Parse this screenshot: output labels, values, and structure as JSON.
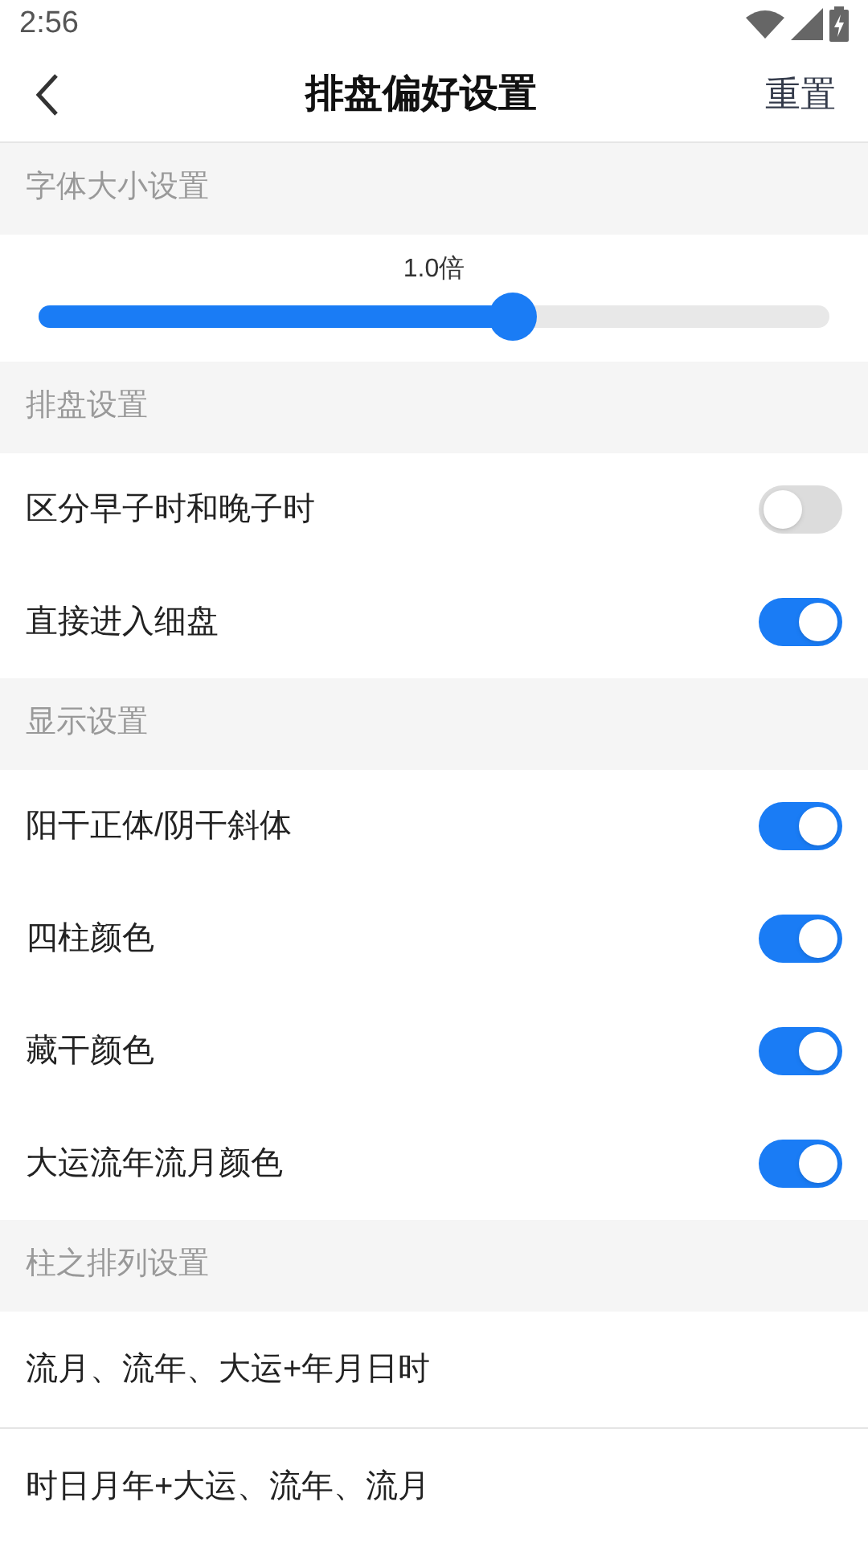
{
  "status_bar": {
    "time": "2:56"
  },
  "header": {
    "title": "排盘偏好设置",
    "action": "重置"
  },
  "sections": [
    {
      "title": "字体大小设置",
      "kind": "slider",
      "slider": {
        "reading": "1.0倍",
        "level": 0.6
      }
    },
    {
      "title": "排盘设置",
      "kind": "toggles",
      "items": [
        {
          "label": "区分早子时和晚子时",
          "on": false
        },
        {
          "label": "直接进入细盘",
          "on": true
        }
      ]
    },
    {
      "title": "显示设置",
      "kind": "toggles",
      "items": [
        {
          "label": "阳干正体/阴干斜体",
          "on": true
        },
        {
          "label": "四柱颜色",
          "on": true
        },
        {
          "label": "藏干颜色",
          "on": true
        },
        {
          "label": "大运流年流月颜色",
          "on": true
        }
      ]
    },
    {
      "title": "柱之排列设置",
      "kind": "options",
      "items": [
        {
          "label": "流月、流年、大运+年月日时"
        },
        {
          "label": "时日月年+大运、流年、流月"
        }
      ]
    }
  ]
}
